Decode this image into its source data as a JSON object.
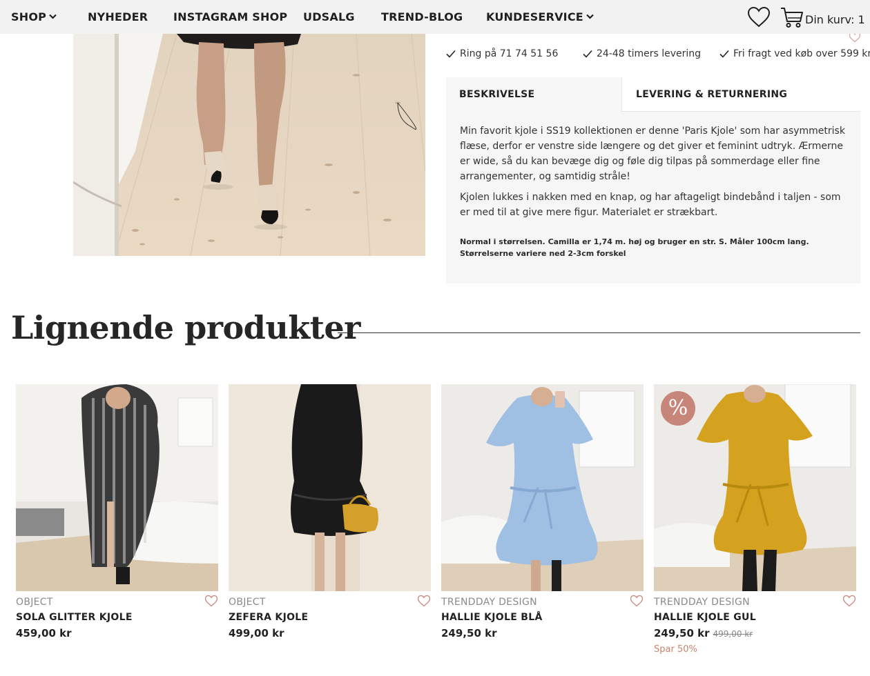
{
  "nav": {
    "items": [
      {
        "label": "SHOP",
        "dropdown": true
      },
      {
        "label": "NYHEDER",
        "dropdown": false
      },
      {
        "label": "INSTAGRAM SHOP",
        "dropdown": false
      },
      {
        "label": "UDSALG",
        "dropdown": false
      },
      {
        "label": "TREND-BLOG",
        "dropdown": false
      },
      {
        "label": "KUNDESERVICE",
        "dropdown": true
      }
    ],
    "wishlist_icon": "heart-icon",
    "cart_icon": "cart-icon",
    "cart_label": "Din kurv: 1"
  },
  "usps": [
    {
      "icon": "check-icon",
      "text": "Ring på 71 74 51 56"
    },
    {
      "icon": "check-icon",
      "text": "24-48 timers levering"
    },
    {
      "icon": "check-icon",
      "text": "Fri fragt ved køb over 599 kr"
    }
  ],
  "tabs": [
    {
      "label": "BESKRIVELSE",
      "active": true
    },
    {
      "label": "LEVERING & RETURNERING",
      "active": false
    }
  ],
  "description": {
    "paragraphs": [
      "Min favorit kjole i SS19 kollektionen er denne 'Paris Kjole' som har asymmetrisk flæse, derfor er venstre side længere og det giver et feminint udtryk. Ærmerne er wide, så du kan bevæge dig og føle dig tilpas på sommerdage eller fine arrangementer, og samtidig stråle!",
      "Kjolen lukkes i nakken med en knap, og har aftageligt bindebånd i taljen - som er med til at give mere figur. Materialet er strækbart."
    ],
    "note": "Normal i størrelsen. Camilla er 1,74 m. høj og bruger en str. S. Måler 100cm lang. Størrelserne variere ned 2-3cm forskel"
  },
  "related": {
    "title": "Lignende produkter",
    "products": [
      {
        "brand": "OBJECT",
        "name": "SOLA GLITTER KJOLE",
        "price": "459,00 kr",
        "old_price": "",
        "save": "",
        "sale_badge": ""
      },
      {
        "brand": "OBJECT",
        "name": "ZEFERA KJOLE",
        "price": "499,00 kr",
        "old_price": "",
        "save": "",
        "sale_badge": ""
      },
      {
        "brand": "TRENDDAY DESIGN",
        "name": "HALLIE KJOLE BLÅ",
        "price": "249,50 kr",
        "old_price": "",
        "save": "",
        "sale_badge": ""
      },
      {
        "brand": "TRENDDAY DESIGN",
        "name": "HALLIE KJOLE GUL",
        "price": "249,50 kr",
        "old_price": "499,00 kr",
        "save": "Spar 50%",
        "sale_badge": "%"
      }
    ]
  },
  "colors": {
    "nav_bg": "#f2f2f2",
    "desc_bg": "#f6f6f6",
    "sale_badge": "#c8857a",
    "save_text": "#c8856d"
  }
}
